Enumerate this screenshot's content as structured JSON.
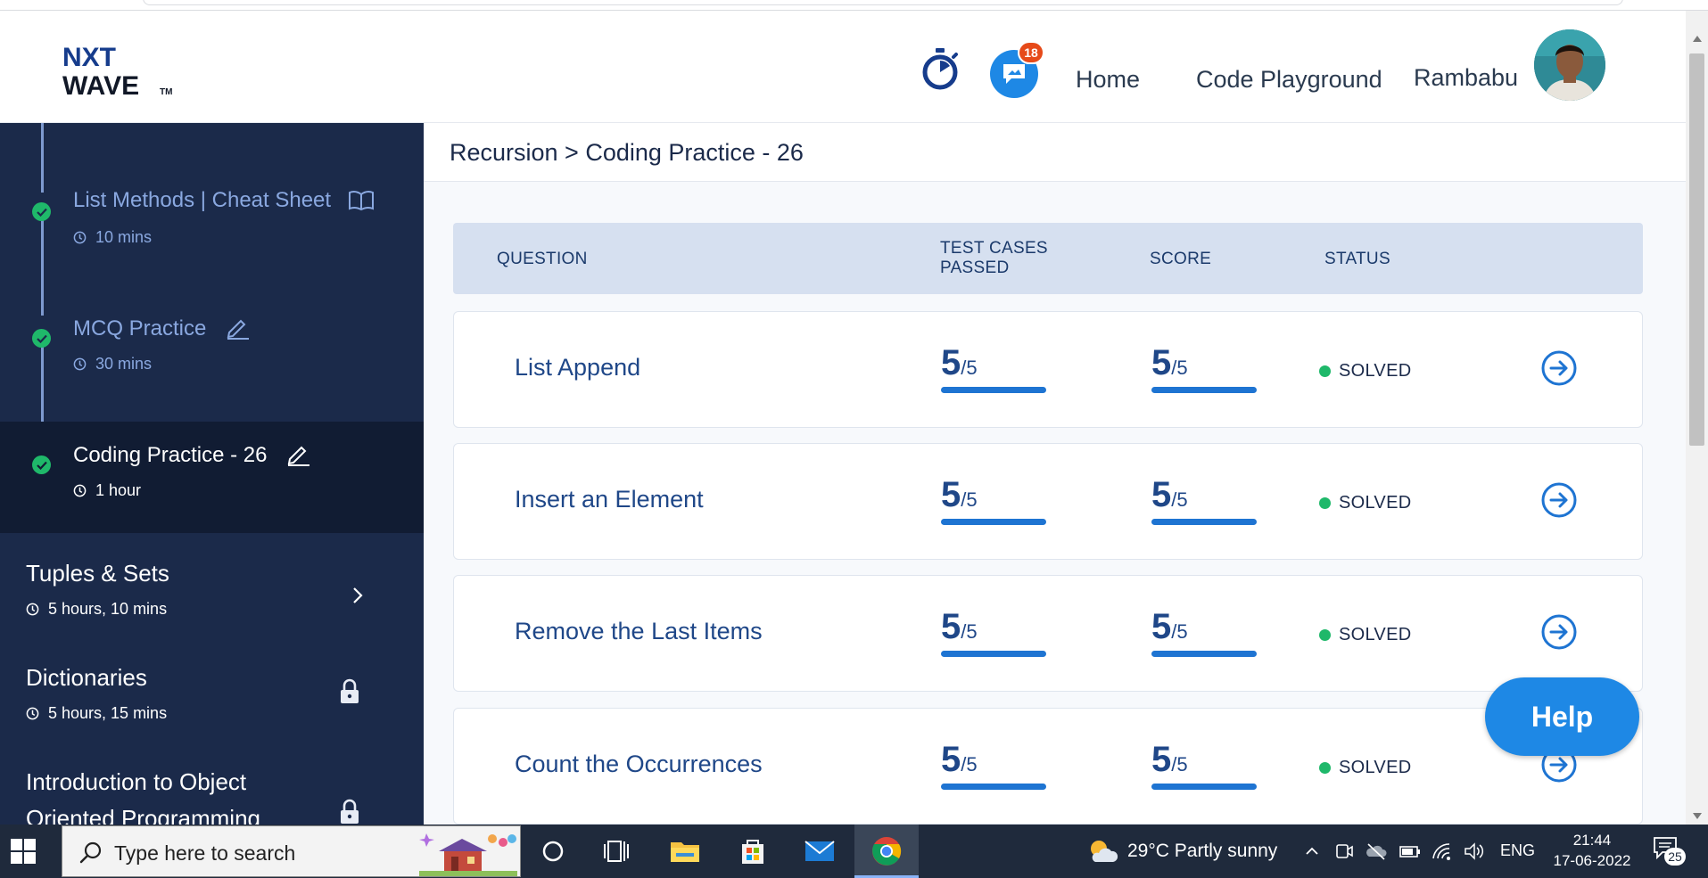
{
  "header": {
    "logo_text_top": "NXT",
    "logo_text_bottom": "WAVE",
    "logo_tm": "TM",
    "notification_count": "18",
    "nav": {
      "home": "Home",
      "code_playground": "Code Playground"
    },
    "username": "Rambabu"
  },
  "sidebar": {
    "items": [
      {
        "title": "List Methods | Cheat Sheet",
        "duration": "10 mins",
        "icon": "book-icon",
        "state": "completed"
      },
      {
        "title": "MCQ Practice",
        "duration": "30 mins",
        "icon": "pencil-icon",
        "state": "completed"
      },
      {
        "title": "Coding Practice - 26",
        "duration": "1 hour",
        "icon": "pencil-icon",
        "state": "current"
      }
    ],
    "modules": [
      {
        "title": "Tuples & Sets",
        "duration": "5 hours, 10 mins",
        "icon": "chevron-right-icon"
      },
      {
        "title": "Dictionaries",
        "duration": "5 hours, 15 mins",
        "icon": "lock-icon"
      },
      {
        "title_line1": "Introduction to Object",
        "title_line2": "Oriented Programming",
        "icon": "lock-icon"
      }
    ]
  },
  "main": {
    "breadcrumb": "Recursion > Coding Practice - 26",
    "table": {
      "headers": {
        "question": "QUESTION",
        "test_cases_line1": "TEST CASES",
        "test_cases_line2": "PASSED",
        "score": "SCORE",
        "status": "STATUS"
      },
      "rows": [
        {
          "question": "List Append",
          "passed": "5",
          "passed_total": "/5",
          "score": "5",
          "score_total": "/5",
          "status": "SOLVED",
          "progress": 1.0
        },
        {
          "question": "Insert an Element",
          "passed": "5",
          "passed_total": "/5",
          "score": "5",
          "score_total": "/5",
          "status": "SOLVED",
          "progress": 1.0
        },
        {
          "question": "Remove the Last Items",
          "passed": "5",
          "passed_total": "/5",
          "score": "5",
          "score_total": "/5",
          "status": "SOLVED",
          "progress": 1.0
        },
        {
          "question": "Count the Occurrences",
          "passed": "5",
          "passed_total": "/5",
          "score": "5",
          "score_total": "/5",
          "status": "SOLVED",
          "progress": 1.0
        }
      ]
    }
  },
  "help_button": "Help",
  "taskbar": {
    "search_placeholder": "Type here to search",
    "weather": "29°C  Partly sunny",
    "language": "ENG",
    "time": "21:44",
    "date": "17-06-2022",
    "notification_count": "25"
  },
  "colors": {
    "sidebar_bg": "#1b2a4a",
    "sidebar_active_bg": "#111c33",
    "accent_blue": "#1e74d2",
    "success_green": "#1fb86a",
    "table_header_bg": "#d6e0f0",
    "help_blue": "#1e88e5",
    "badge_red": "#e64a19"
  }
}
